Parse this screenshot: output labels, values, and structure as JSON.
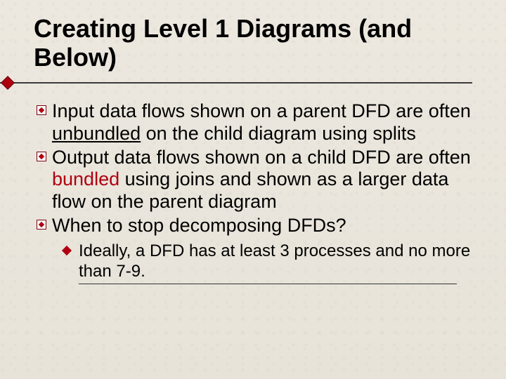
{
  "title": "Creating Level 1 Diagrams (and Below)",
  "bullets": [
    {
      "pre": "Input data flows shown on a parent DFD are often ",
      "kw": "unbundled",
      "kw_class": "underline",
      "post": " on the child diagram using splits"
    },
    {
      "pre": "Output data flows shown on a child DFD are often ",
      "kw": "bundled",
      "kw_class": "red",
      "post": " using joins and shown as a larger data flow on the parent diagram"
    },
    {
      "pre": "When to stop decomposing DFDs?",
      "kw": "",
      "kw_class": "",
      "post": ""
    }
  ],
  "sub_bullet": "Ideally, a DFD has at least 3 processes and no more than 7-9."
}
